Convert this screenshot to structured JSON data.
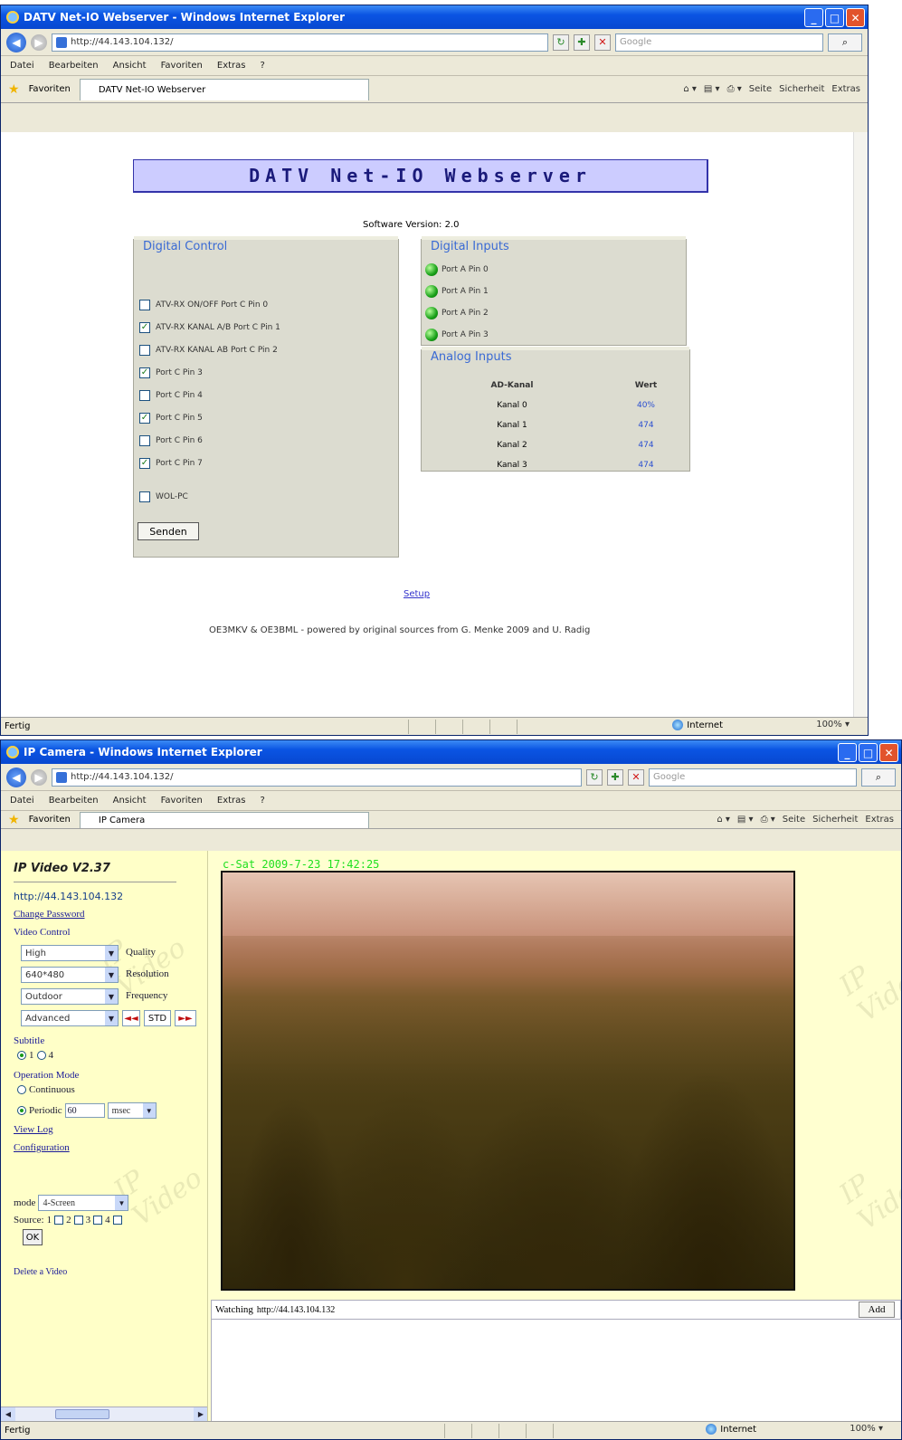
{
  "win1": {
    "title": "DATV Net-IO Webserver - Windows Internet Explorer",
    "address": "http://44.143.104.132/",
    "search_placeholder": "Google",
    "menu": [
      "Datei",
      "Bearbeiten",
      "Ansicht",
      "Favoriten",
      "Extras",
      "?"
    ],
    "favorites_label": "Favoriten",
    "tab_label": "DATV Net-IO Webserver",
    "tools": [
      "Seite",
      "Sicherheit",
      "Extras"
    ],
    "banner": "DATV Net-IO Webserver",
    "software_version": "Software Version: 2.0",
    "digital_control": {
      "title": "Digital Control",
      "items": [
        {
          "label": "ATV-RX ON/OFF Port C Pin 0",
          "checked": false
        },
        {
          "label": "ATV-RX KANAL A/B Port C Pin 1",
          "checked": true
        },
        {
          "label": "ATV-RX KANAL AB Port C Pin 2",
          "checked": false
        },
        {
          "label": "Port C Pin 3",
          "checked": true
        },
        {
          "label": "Port C Pin 4",
          "checked": false
        },
        {
          "label": "Port C Pin 5",
          "checked": true
        },
        {
          "label": "Port C Pin 6",
          "checked": false
        },
        {
          "label": "Port C Pin 7",
          "checked": true
        }
      ],
      "wol": {
        "label": "WOL-PC",
        "checked": false
      },
      "send_label": "Senden"
    },
    "digital_inputs": {
      "title": "Digital Inputs",
      "items": [
        "Port A Pin 0",
        "Port A Pin 1",
        "Port A Pin 2",
        "Port A Pin 3"
      ]
    },
    "analog_inputs": {
      "title": "Analog Inputs",
      "headers": [
        "AD-Kanal",
        "Wert"
      ],
      "rows": [
        {
          "kanal": "Kanal 0",
          "wert": "40%"
        },
        {
          "kanal": "Kanal 1",
          "wert": "474"
        },
        {
          "kanal": "Kanal 2",
          "wert": "474"
        },
        {
          "kanal": "Kanal 3",
          "wert": "474"
        }
      ]
    },
    "setup_link": "Setup",
    "footer": "OE3MKV & OE3BML - powered by original sources from G. Menke 2009 and U. Radig",
    "status": "Fertig",
    "zone": "Internet",
    "zoom": "100%"
  },
  "win2": {
    "title": "IP Camera - Windows Internet Explorer",
    "address": "http://44.143.104.132/",
    "search_placeholder": "Google",
    "menu": [
      "Datei",
      "Bearbeiten",
      "Ansicht",
      "Favoriten",
      "Extras",
      "?"
    ],
    "favorites_label": "Favoriten",
    "tab_label": "IP Camera",
    "tools": [
      "Seite",
      "Sicherheit",
      "Extras"
    ],
    "app_title": "IP Video V2.37",
    "url": "http://44.143.104.132",
    "change_password": "Change Password",
    "video_control": "Video Control",
    "quality": {
      "value": "High",
      "label": "Quality"
    },
    "resolution": {
      "value": "640*480",
      "label": "Resolution"
    },
    "frequency": {
      "value": "Outdoor",
      "label": "Frequency"
    },
    "advanced": {
      "value": "Advanced",
      "std_label": "STD",
      "prev": "◄◄",
      "next": "►►"
    },
    "subtitle_label": "Subtitle",
    "subtitle_options": [
      "1",
      "4"
    ],
    "operation_mode": "Operation Mode",
    "continuous": "Continuous",
    "periodic": {
      "label": "Periodic",
      "value": "60",
      "unit": "msec"
    },
    "view_log": "View Log",
    "configuration": "Configuration",
    "mode": {
      "label": "mode",
      "value": "4-Screen"
    },
    "source": {
      "label": "Source:",
      "channels": [
        "1",
        "2",
        "3",
        "4"
      ]
    },
    "ok_label": "OK",
    "delete_video": "Delete a Video",
    "timestamp": "c-Sat  2009-7-23  17:42:25",
    "watching_label": "Watching",
    "watching_url": "http://44.143.104.132",
    "add_label": "Add",
    "watermark": "IP Video",
    "status": "Fertig",
    "zone": "Internet",
    "zoom": "100%"
  }
}
